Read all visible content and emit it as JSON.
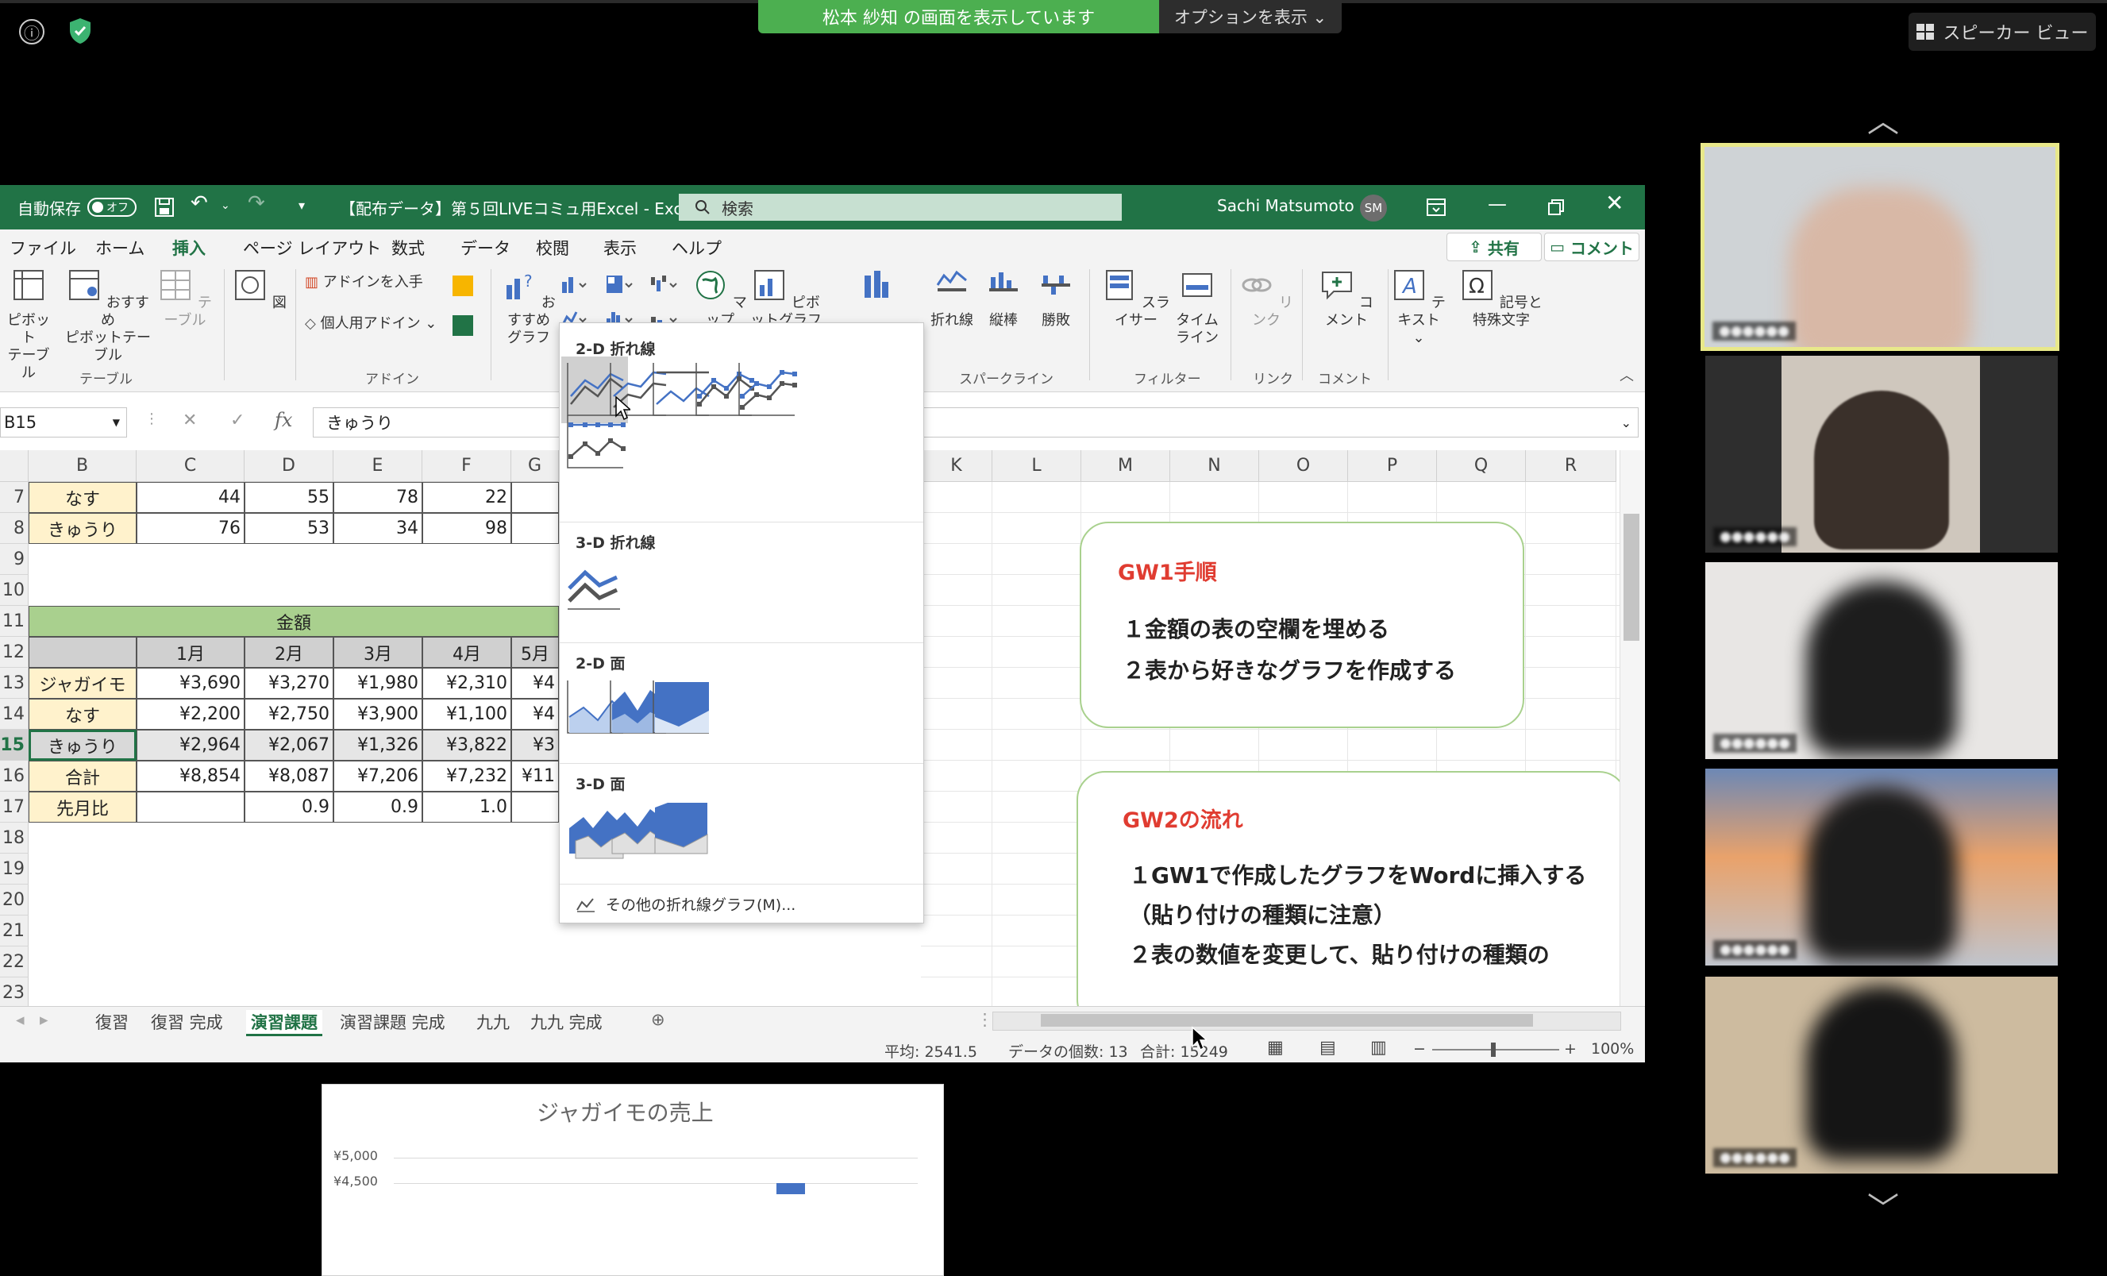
{
  "zoom": {
    "banner_text": "松本 紗知 の画面を表示しています",
    "options_label": "オプションを表示 ⌄",
    "speaker_view_label": "スピーカー ビュー",
    "info_icon": "ⓘ",
    "shield_icon": "shield-check-icon",
    "chevron_up": "︿",
    "chevron_down": "﹀",
    "participant_names": [
      "●●●●●●",
      "●●●●●●",
      "●●●●●●",
      "●●●●●●",
      "●●●●●●"
    ]
  },
  "excel": {
    "autosave_label": "自動保存",
    "autosave_state": "オフ",
    "file_title": "【配布データ】第５回LIVEコミュ用Excel  -  Excel",
    "search_placeholder": "検索",
    "user_name": "Sachi Matsumoto",
    "user_initials": "SM",
    "menu": [
      "ファイル",
      "ホーム",
      "挿入",
      "ページ レイアウト",
      "数式",
      "データ",
      "校閲",
      "表示",
      "ヘルプ"
    ],
    "active_menu": "挿入",
    "share_label": "共有",
    "comment_label": "コメント",
    "ribbon": {
      "pivot_table": "ピボット\nテーブル",
      "recommended_pivot": "おすすめ\nピボットテーブル",
      "table": "テーブル",
      "group_table": "テーブル",
      "illustrations": "図",
      "get_addins": "アドインを入手",
      "my_addins": "個人用アドイン",
      "group_addins": "アドイン",
      "recommended_charts": "おすすめ\nグラフ",
      "map": "マップ",
      "pivot_chart": "ピボットグラフ",
      "sparkline_line": "折れ線",
      "sparkline_column": "縦棒",
      "sparkline_winloss": "勝敗",
      "group_sparklines": "スパークライン",
      "slicer": "スライサー",
      "timeline": "タイム\nライン",
      "group_filters": "フィルター",
      "link": "リンク",
      "group_links": "リンク",
      "comment": "コメント",
      "group_comments": "コメント",
      "text": "テキスト",
      "symbols": "記号と\n特殊文字"
    },
    "name_box": "B15",
    "formula_value": "きゅうり",
    "columns_left": [
      "B",
      "C",
      "D",
      "E",
      "F",
      "G"
    ],
    "columns_right": [
      "K",
      "L",
      "M",
      "N",
      "O",
      "P",
      "Q",
      "R"
    ],
    "rows": [
      "7",
      "8",
      "9",
      "10",
      "11",
      "12",
      "13",
      "14",
      "15",
      "16",
      "17",
      "18",
      "19",
      "20",
      "21",
      "22",
      "23"
    ],
    "table_top": [
      {
        "label": "なす",
        "values": [
          "44",
          "55",
          "78",
          "22"
        ]
      },
      {
        "label": "きゅうり",
        "values": [
          "76",
          "53",
          "34",
          "98"
        ]
      }
    ],
    "amount_header": "金額",
    "month_headers": [
      "1月",
      "2月",
      "3月",
      "4月",
      "5月"
    ],
    "amount_rows": [
      {
        "label": "ジャガイモ",
        "values": [
          "¥3,690",
          "¥3,270",
          "¥1,980",
          "¥2,310",
          "¥4"
        ]
      },
      {
        "label": "なす",
        "values": [
          "¥2,200",
          "¥2,750",
          "¥3,900",
          "¥1,100",
          "¥4"
        ]
      },
      {
        "label": "きゅうり",
        "values": [
          "¥2,964",
          "¥2,067",
          "¥1,326",
          "¥3,822",
          "¥3"
        ]
      },
      {
        "label": "合計",
        "values": [
          "¥8,854",
          "¥8,087",
          "¥7,206",
          "¥7,232",
          "¥11"
        ]
      }
    ],
    "ratio_row": {
      "label": "先月比",
      "values": [
        "",
        "0.9",
        "0.9",
        "1.0",
        ""
      ]
    },
    "gw1": {
      "title": "GW1手順",
      "lines": [
        "１金額の表の空欄を埋める",
        "２表から好きなグラフを作成する"
      ]
    },
    "gw2": {
      "title": "GW2の流れ",
      "lines": [
        "１GW1で作成したグラフをWordに挿入する",
        "（貼り付けの種類に注意）",
        "２表の数値を変更して、貼り付けの種類の"
      ]
    },
    "chart_preview": {
      "title": "ジャガイモの売上",
      "ticks": [
        "¥5,000",
        "¥4,500"
      ]
    },
    "sheet_tabs": [
      "復習",
      "復習 完成",
      "演習課題",
      "演習課題 完成",
      "九九",
      "九九 完成"
    ],
    "active_sheet": "演習課題",
    "status": {
      "average": "平均: 2541.5",
      "count": "データの個数: 13",
      "sum": "合計: 15249",
      "zoom": "100%"
    },
    "line_dropdown": {
      "section_2d_line": "2-D 折れ線",
      "section_3d_line": "3-D 折れ線",
      "section_2d_area": "2-D 面",
      "section_3d_area": "3-D 面",
      "more_label": "その他の折れ線グラフ(M)..."
    }
  },
  "colors": {
    "excel_green": "#217346",
    "zoom_green": "#4caf50",
    "gw_title_red": "#e03c31",
    "gw_border": "#a9d18e",
    "chart_blue": "#4472c4"
  }
}
